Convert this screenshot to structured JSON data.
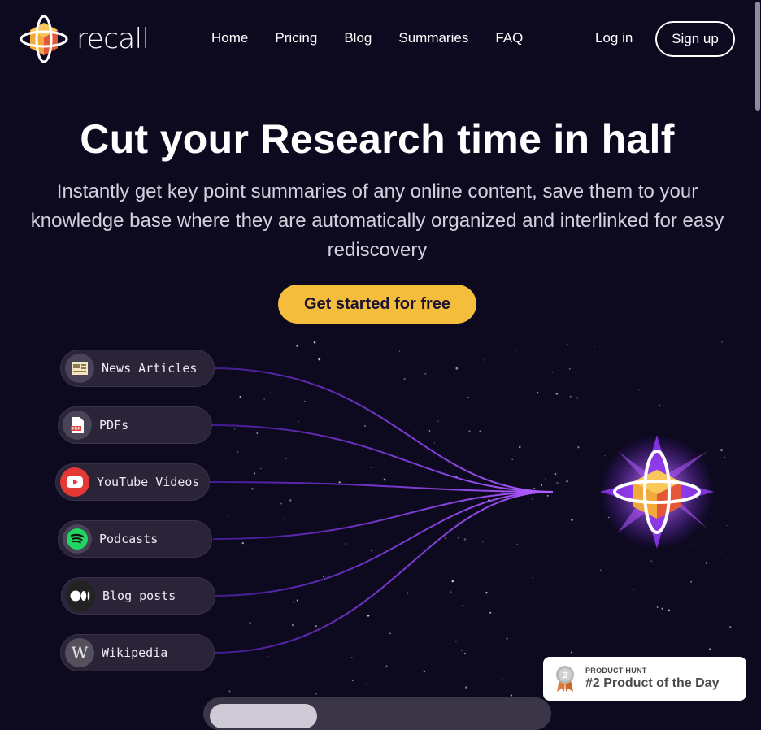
{
  "brand": {
    "name": "recall"
  },
  "nav": {
    "links": [
      "Home",
      "Pricing",
      "Blog",
      "Summaries",
      "FAQ"
    ],
    "login": "Log in",
    "signup": "Sign up"
  },
  "hero": {
    "title": "Cut your Research time in half",
    "subtitle": "Instantly get key point summaries of any online content, save them to your knowledge base where they are automatically organized and interlinked for easy rediscovery",
    "cta": "Get started for free"
  },
  "sources": [
    {
      "label": "News Articles",
      "icon": "newspaper-icon"
    },
    {
      "label": "PDFs",
      "icon": "pdf-icon"
    },
    {
      "label": "YouTube Videos",
      "icon": "youtube-icon"
    },
    {
      "label": "Podcasts",
      "icon": "spotify-icon"
    },
    {
      "label": "Blog posts",
      "icon": "medium-icon"
    },
    {
      "label": "Wikipedia",
      "icon": "wikipedia-icon"
    }
  ],
  "badge": {
    "kicker": "PRODUCT HUNT",
    "title": "#2 Product of the Day",
    "rank": "2"
  },
  "colors": {
    "background": "#0d0a1f",
    "accent": "#f5bd3c",
    "glow": "#a040ff"
  }
}
